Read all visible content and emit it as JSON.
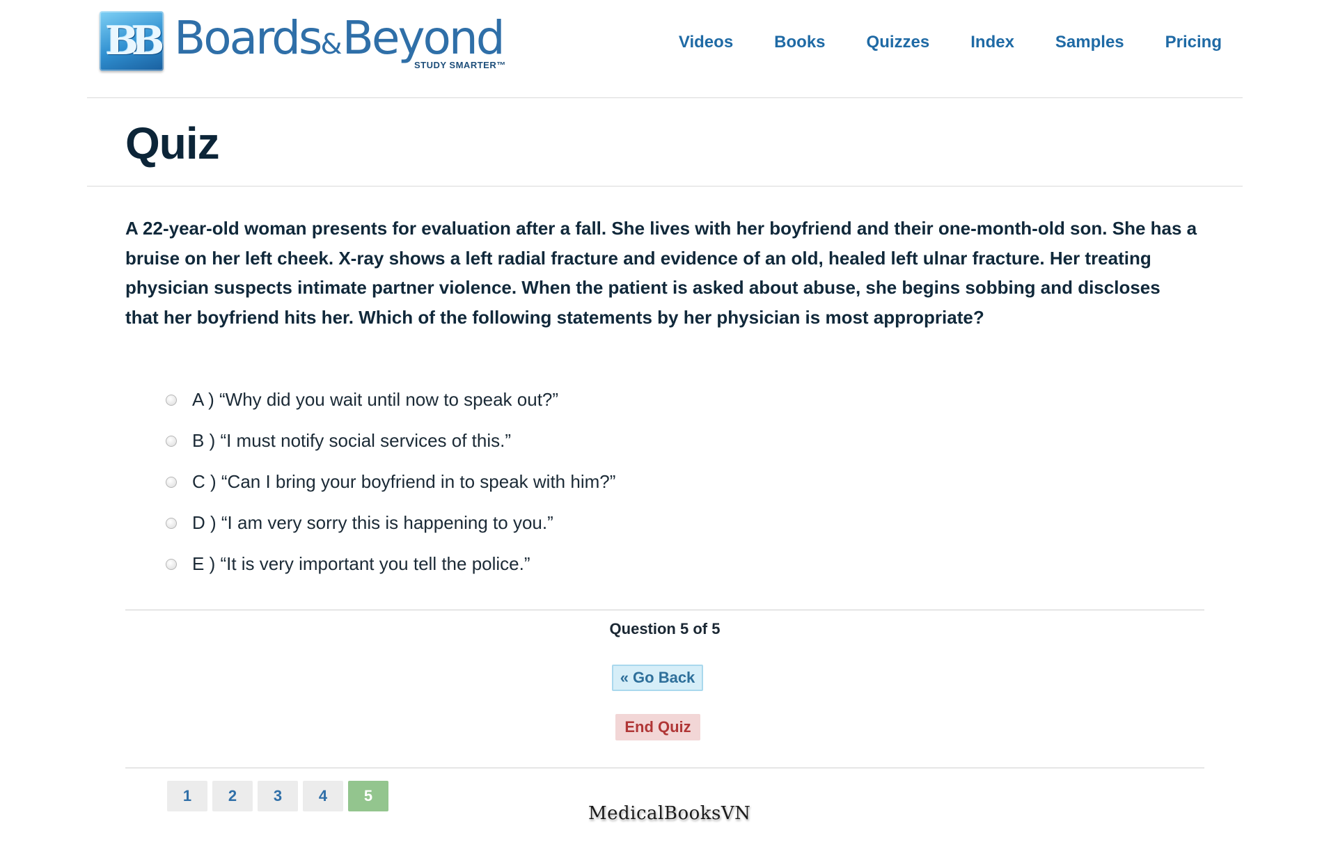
{
  "brand": {
    "logo_mark": "BB",
    "name_part1": "Boards",
    "name_amp": "&",
    "name_part2": "Beyond",
    "tagline": "STUDY SMARTER™"
  },
  "nav": {
    "items": [
      {
        "label": "Videos"
      },
      {
        "label": "Books"
      },
      {
        "label": "Quizzes"
      },
      {
        "label": "Index"
      },
      {
        "label": "Samples"
      },
      {
        "label": "Pricing"
      }
    ]
  },
  "page": {
    "title": "Quiz"
  },
  "question": {
    "text": "A 22-year-old woman presents for evaluation after a fall. She lives with her boyfriend and their one-month-old son. She has a bruise on her left cheek. X-ray shows a left radial fracture and evidence of an old, healed left ulnar fracture. Her treating physician suspects intimate partner violence. When the patient is asked about abuse, she begins sobbing and discloses that her boyfriend hits her. Which of the following statements by her physician is most appropriate?",
    "answers": [
      {
        "text": "A ) “Why did you wait until now to speak out?”"
      },
      {
        "text": "B ) “I must notify social services of this.”"
      },
      {
        "text": "C ) “Can I bring your boyfriend in to speak with him?”"
      },
      {
        "text": "D ) “I am very sorry this is happening to you.”"
      },
      {
        "text": "E ) “It is very important you tell the police.”"
      }
    ]
  },
  "controls": {
    "progress": "Question 5 of 5",
    "back_label": "« Go Back",
    "end_label": "End Quiz"
  },
  "pager": {
    "pages": [
      "1",
      "2",
      "3",
      "4",
      "5"
    ],
    "current": "5"
  },
  "watermark": "MedicalBooksVN",
  "colors": {
    "nav_link": "#1f6aa5",
    "back_button_bg": "#d6eef8",
    "end_button_bg": "#f2d6d6",
    "end_button_text": "#b03636",
    "active_page_bg": "#93c58e"
  }
}
